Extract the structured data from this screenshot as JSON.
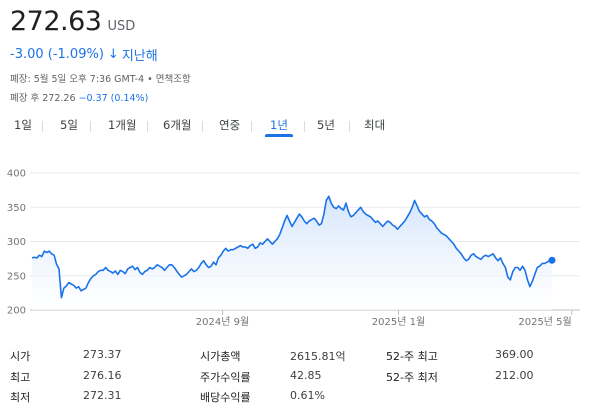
{
  "quote": {
    "price": "272.63",
    "currency": "USD",
    "change": "-3.00 (-1.09%)",
    "change_arrow": "↓",
    "period_label": "지난해",
    "closing_info": "폐장: 5월 5일 오후 7:36 GMT-4 • 면책조항",
    "after_hours_label": "폐장 후 272.26",
    "after_hours_change": "−0.37 (0.14%)"
  },
  "tabs": [
    {
      "label": "1일",
      "active": false
    },
    {
      "label": "5일",
      "active": false
    },
    {
      "label": "1개월",
      "active": false
    },
    {
      "label": "6개월",
      "active": false
    },
    {
      "label": "연중",
      "active": false
    },
    {
      "label": "1년",
      "active": true
    },
    {
      "label": "5년",
      "active": false
    },
    {
      "label": "최대",
      "active": false
    }
  ],
  "colors": {
    "accent": "#1a73e8",
    "line": "#1a73e8",
    "fill_top": "#d2e3fc",
    "grid": "#e8eaed"
  },
  "chart_data": {
    "type": "area",
    "title": "",
    "xlabel": "",
    "ylabel": "",
    "ylim": [
      200,
      400
    ],
    "yticks": [
      200,
      250,
      300,
      350,
      400
    ],
    "xtick_labels": [
      "2024년 9월",
      "2025년 1월",
      "2025년 5월"
    ],
    "xtick_positions": [
      0.35,
      0.67,
      0.985
    ],
    "grid": true,
    "series": [
      {
        "values": [
          276,
          277,
          276,
          280,
          278,
          286,
          284,
          286,
          282,
          280,
          267,
          260,
          218,
          232,
          235,
          240,
          238,
          236,
          232,
          234,
          228,
          230,
          232,
          240,
          246,
          250,
          252,
          256,
          258,
          258,
          262,
          258,
          256,
          254,
          257,
          252,
          258,
          256,
          253,
          260,
          262,
          264,
          259,
          262,
          255,
          252,
          256,
          258,
          262,
          260,
          262,
          266,
          264,
          262,
          258,
          262,
          266,
          266,
          262,
          257,
          252,
          248,
          250,
          252,
          256,
          260,
          256,
          258,
          262,
          268,
          272,
          266,
          262,
          264,
          270,
          266,
          276,
          280,
          286,
          290,
          286,
          288,
          288,
          290,
          292,
          294,
          292,
          292,
          290,
          294,
          296,
          290,
          292,
          298,
          296,
          300,
          304,
          300,
          296,
          300,
          304,
          310,
          320,
          330,
          338,
          330,
          322,
          328,
          334,
          340,
          336,
          330,
          326,
          330,
          332,
          334,
          330,
          324,
          326,
          340,
          360,
          366,
          356,
          350,
          348,
          352,
          348,
          346,
          356,
          344,
          336,
          338,
          342,
          346,
          350,
          344,
          340,
          338,
          336,
          332,
          328,
          330,
          326,
          322,
          326,
          330,
          328,
          324,
          322,
          318,
          322,
          326,
          330,
          336,
          342,
          350,
          360,
          352,
          344,
          340,
          336,
          338,
          332,
          330,
          326,
          320,
          316,
          312,
          310,
          308,
          304,
          300,
          296,
          290,
          286,
          282,
          276,
          272,
          274,
          280,
          282,
          278,
          276,
          274,
          278,
          280,
          278,
          280,
          282,
          276,
          272,
          276,
          268,
          262,
          248,
          244,
          256,
          262,
          262,
          258,
          264,
          258,
          244,
          234,
          242,
          252,
          262,
          264,
          268,
          268,
          270,
          272,
          274
        ]
      }
    ],
    "last_value": 272.63
  },
  "stats": [
    {
      "label": "시가",
      "value": "273.37"
    },
    {
      "label": "최고",
      "value": "276.16"
    },
    {
      "label": "최저",
      "value": "272.31"
    },
    {
      "label": "시가총액",
      "value": "2615.81억"
    },
    {
      "label": "주가수익률",
      "value": "42.85"
    },
    {
      "label": "배당수익률",
      "value": "0.61%"
    },
    {
      "label": "52-주 최고",
      "value": "369.00"
    },
    {
      "label": "52-주 최저",
      "value": "212.00"
    }
  ]
}
